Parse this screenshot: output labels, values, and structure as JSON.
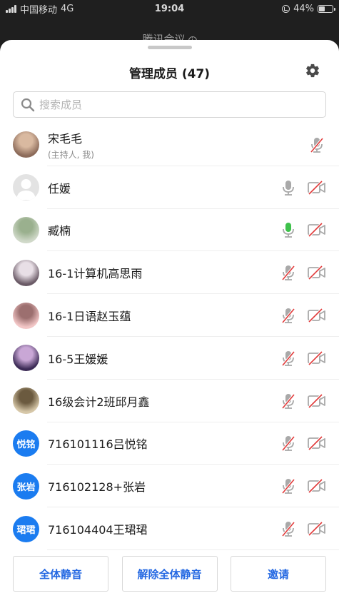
{
  "status_bar": {
    "carrier": "中国移动",
    "network": "4G",
    "time": "19:04",
    "battery": "44%",
    "battery_level": 0.44
  },
  "background_title": "腾讯会议",
  "sheet": {
    "title": "管理成员 (47)",
    "settings_icon": "gear-icon"
  },
  "search": {
    "placeholder": "搜索成员",
    "value": ""
  },
  "colors": {
    "accent": "#2468e2",
    "avatar_blue": "#1b7cf0",
    "mic_active": "#3ec14b",
    "muted_red": "#e23b3b",
    "icon_gray": "#a9a9a9"
  },
  "members": [
    {
      "name": "宋毛毛",
      "sub": "(主持人, 我)",
      "avatar": "photo",
      "mic": "muted",
      "video": "none"
    },
    {
      "name": "任媛",
      "sub": "",
      "avatar": "default",
      "mic": "on",
      "video": "off"
    },
    {
      "name": "臧楠",
      "sub": "",
      "avatar": "photo",
      "mic": "speaking",
      "video": "off"
    },
    {
      "name": "16-1计算机高思雨",
      "sub": "",
      "avatar": "photo",
      "mic": "muted",
      "video": "off"
    },
    {
      "name": "16-1日语赵玉蕴",
      "sub": "",
      "avatar": "photo",
      "mic": "muted",
      "video": "off"
    },
    {
      "name": "16-5王媛媛",
      "sub": "",
      "avatar": "photo",
      "mic": "muted",
      "video": "off"
    },
    {
      "name": "16级会计2班邱月鑫",
      "sub": "",
      "avatar": "photo",
      "mic": "muted",
      "video": "off"
    },
    {
      "name": "716101116吕悦铭",
      "sub": "",
      "avatar": "text",
      "avatar_text": "悦铭",
      "mic": "muted",
      "video": "off"
    },
    {
      "name": "716102128+张岩",
      "sub": "",
      "avatar": "text",
      "avatar_text": "张岩",
      "mic": "muted",
      "video": "off"
    },
    {
      "name": "716104404王珺珺",
      "sub": "",
      "avatar": "text",
      "avatar_text": "珺珺",
      "mic": "muted",
      "video": "off"
    }
  ],
  "actions": {
    "mute_all": "全体静音",
    "unmute_all": "解除全体静音",
    "invite": "邀请"
  }
}
